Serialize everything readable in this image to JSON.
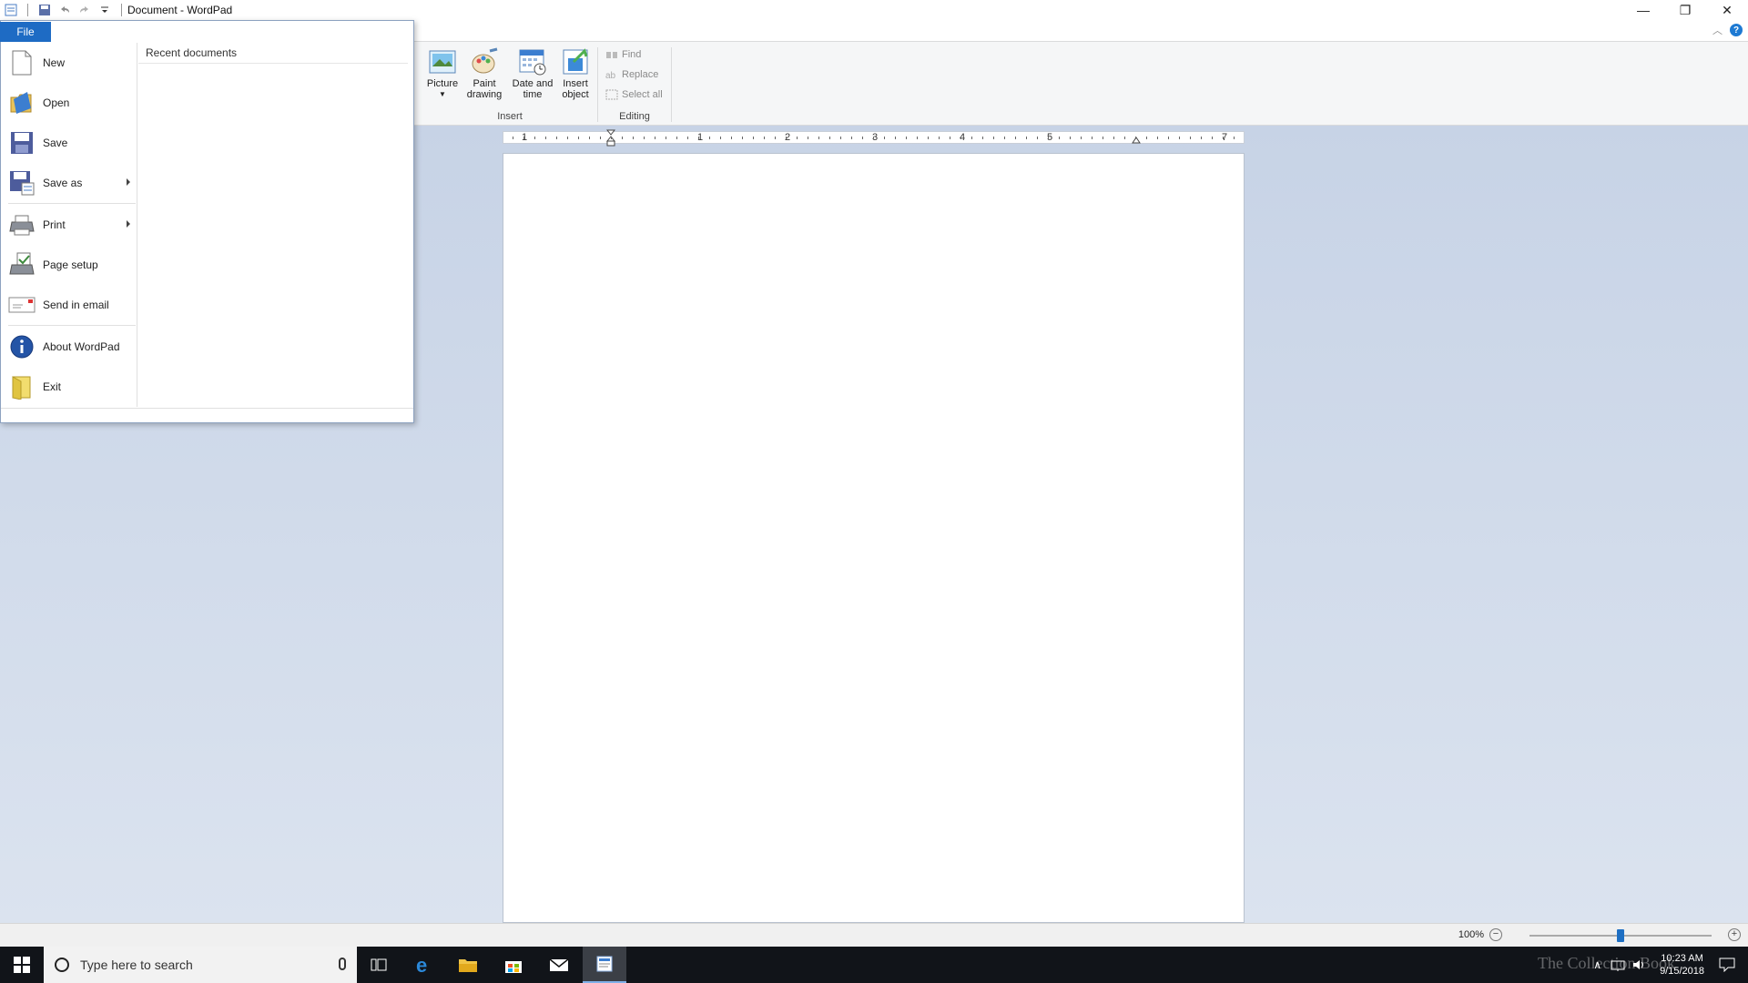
{
  "window": {
    "title": "Document - WordPad",
    "controls": {
      "minimize": "—",
      "restore": "❐",
      "close": "✕"
    }
  },
  "ribbon": {
    "help_icon": "?",
    "insert_group": {
      "label": "Insert",
      "buttons": [
        {
          "label_line1": "Picture",
          "label_line2": "",
          "icon": "picture-icon"
        },
        {
          "label_line1": "Paint",
          "label_line2": "drawing",
          "icon": "paint-drawing-icon"
        },
        {
          "label_line1": "Date and",
          "label_line2": "time",
          "icon": "date-time-icon"
        },
        {
          "label_line1": "Insert",
          "label_line2": "object",
          "icon": "insert-object-icon"
        }
      ]
    },
    "editing_group": {
      "label": "Editing",
      "find": "Find",
      "replace": "Replace",
      "select_all": "Select all"
    }
  },
  "ruler": {
    "numbers": [
      "1",
      "1",
      "2",
      "3",
      "4",
      "5",
      "7"
    ]
  },
  "file_menu": {
    "tab_label": "File",
    "recent_title": "Recent documents",
    "items": [
      {
        "label": "New",
        "icon": "new-document-icon",
        "submenu": false
      },
      {
        "label": "Open",
        "icon": "open-folder-icon",
        "submenu": false
      },
      {
        "label": "Save",
        "icon": "save-floppy-icon",
        "submenu": false
      },
      {
        "label": "Save as",
        "icon": "save-as-icon",
        "submenu": true
      },
      {
        "label": "Print",
        "icon": "printer-icon",
        "submenu": true
      },
      {
        "label": "Page setup",
        "icon": "page-setup-icon",
        "submenu": false
      },
      {
        "label": "Send in email",
        "icon": "email-icon",
        "submenu": false
      },
      {
        "label": "About WordPad",
        "icon": "info-icon",
        "submenu": false
      },
      {
        "label": "Exit",
        "icon": "exit-icon",
        "submenu": false
      }
    ]
  },
  "statusbar": {
    "zoom": "100%",
    "zoom_out": "−",
    "zoom_in": "+",
    "zoom_level": 0.5
  },
  "taskbar": {
    "search_placeholder": "Type here to search",
    "time": "10:23 AM",
    "date": "9/15/2018",
    "watermark": "The Collection Book"
  }
}
